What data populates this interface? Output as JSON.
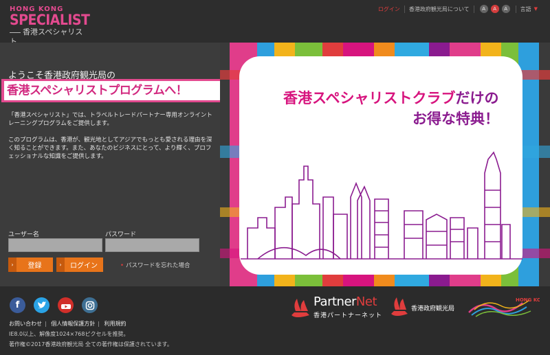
{
  "header": {
    "logo_line1": "HONG KONG",
    "logo_line2": "SPECIALIST",
    "logo_line3": "香港スペシャリスト",
    "nav_login": "ログイン",
    "nav_about": "香港政府観光局について",
    "font_sizes": [
      "A",
      "A",
      "A"
    ],
    "language": "言語"
  },
  "main": {
    "welcome": "ようこそ香港政府観光局の",
    "banner": "香港スペシャリストプログラムへ！",
    "intro1": "「香港スペシャリスト」では、トラベルトレードパートナー専用オンライントレーニングプログラムをご提供します。",
    "intro2": "このプログラムは、香港が、観光地としてアジアでもっとも愛される理由を深く知ることができます。また、あなたのビジネスにとって、より輝く、プロフェッショナルな知識をご提供します。",
    "username_label": "ユーザー名",
    "password_label": "パスワード",
    "username_value": "",
    "password_value": "",
    "register_label": "登録",
    "login_label": "ログイン",
    "forgot_label": "パスワードを忘れた場合"
  },
  "promo": {
    "line1_pink": "香港スペシャリストクラブ",
    "line1_purple": "だけの",
    "line2": "お得な特典！"
  },
  "footer": {
    "links": [
      "お問い合わせ",
      "個人情報保護方針",
      "利用規約"
    ],
    "note": "IE8.0以上、解像度1024×768ピクセルを推奨。",
    "copyright": "著作権©2017香港政府観光局 全ての著作権は保護されています。",
    "partnernet_partner": "Partner",
    "partnernet_net": "Net",
    "partnernet_sub": "香港パートナーネット",
    "hktb": "香港政府観光局",
    "brand": "HONG KONG"
  },
  "colors": {
    "brand_pink": "#e34a8f",
    "orange": "#e8741a",
    "red": "#e03d3d",
    "purple": "#8a1b8f"
  }
}
